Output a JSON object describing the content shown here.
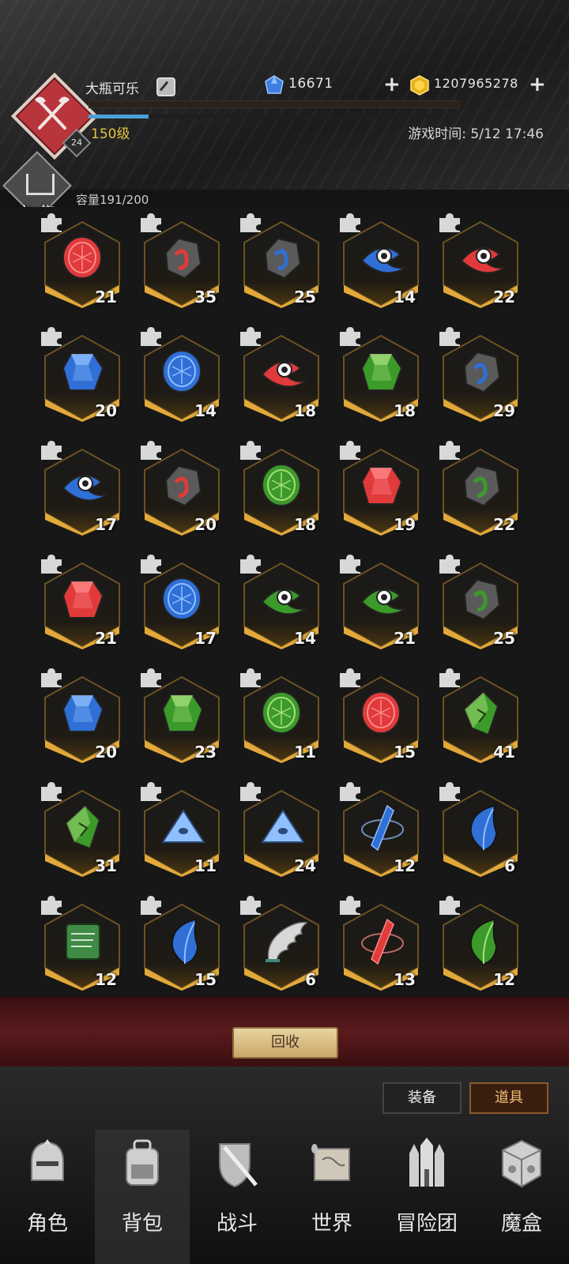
{
  "player": {
    "name": "大瓶可乐",
    "level_badge": "24",
    "level_text": "150级",
    "xp_progress": 0.17
  },
  "currency": {
    "diamonds": "16671",
    "gold": "1207965278"
  },
  "game_time": "游戏时间: 5/12 17:46",
  "market": {
    "label": "市 集"
  },
  "inventory": {
    "capacity": "容量191/200",
    "items": [
      {
        "kind": "coin-red",
        "count": "21"
      },
      {
        "kind": "stone-red",
        "count": "35"
      },
      {
        "kind": "stone-blue",
        "count": "25"
      },
      {
        "kind": "eye-blue",
        "count": "14"
      },
      {
        "kind": "eye-red",
        "count": "22"
      },
      {
        "kind": "gem-blue",
        "count": "20"
      },
      {
        "kind": "coin-blue",
        "count": "14"
      },
      {
        "kind": "eye-red",
        "count": "18"
      },
      {
        "kind": "gem-green",
        "count": "18"
      },
      {
        "kind": "stone-blue",
        "count": "29"
      },
      {
        "kind": "eye-blue",
        "count": "17"
      },
      {
        "kind": "stone-red",
        "count": "20"
      },
      {
        "kind": "coin-green",
        "count": "18"
      },
      {
        "kind": "gem-red",
        "count": "19"
      },
      {
        "kind": "stone-green",
        "count": "22"
      },
      {
        "kind": "gem-red",
        "count": "21"
      },
      {
        "kind": "coin-blue",
        "count": "17"
      },
      {
        "kind": "eye-green",
        "count": "14"
      },
      {
        "kind": "eye-green",
        "count": "21"
      },
      {
        "kind": "stone-green",
        "count": "25"
      },
      {
        "kind": "gem-blue",
        "count": "20"
      },
      {
        "kind": "gem-green",
        "count": "23"
      },
      {
        "kind": "coin-green",
        "count": "11"
      },
      {
        "kind": "coin-red",
        "count": "15"
      },
      {
        "kind": "crystal-green",
        "count": "41"
      },
      {
        "kind": "crystal-green",
        "count": "31"
      },
      {
        "kind": "triangle-blue",
        "count": "11"
      },
      {
        "kind": "triangle-blue",
        "count": "24"
      },
      {
        "kind": "shard-blue",
        "count": "12"
      },
      {
        "kind": "feather-blue",
        "count": "6"
      },
      {
        "kind": "scroll-green",
        "count": "12"
      },
      {
        "kind": "feather-blue",
        "count": "15"
      },
      {
        "kind": "wing-white",
        "count": "6"
      },
      {
        "kind": "shard-red",
        "count": "13"
      },
      {
        "kind": "feather-green",
        "count": "12"
      }
    ]
  },
  "recycle_label": "回收",
  "tabs": {
    "equip": "装备",
    "items": "道具"
  },
  "nav": [
    {
      "label": "角色",
      "icon": "helmet-icon"
    },
    {
      "label": "背包",
      "icon": "backpack-icon"
    },
    {
      "label": "战斗",
      "icon": "sword-shield-icon"
    },
    {
      "label": "世界",
      "icon": "map-icon"
    },
    {
      "label": "冒险团",
      "icon": "castle-icon"
    },
    {
      "label": "魔盒",
      "icon": "magic-box-icon"
    }
  ],
  "colors": {
    "accent_gold": "#e2a93a",
    "level_yellow": "#e1c343",
    "band_red": "#5a1a1c"
  }
}
